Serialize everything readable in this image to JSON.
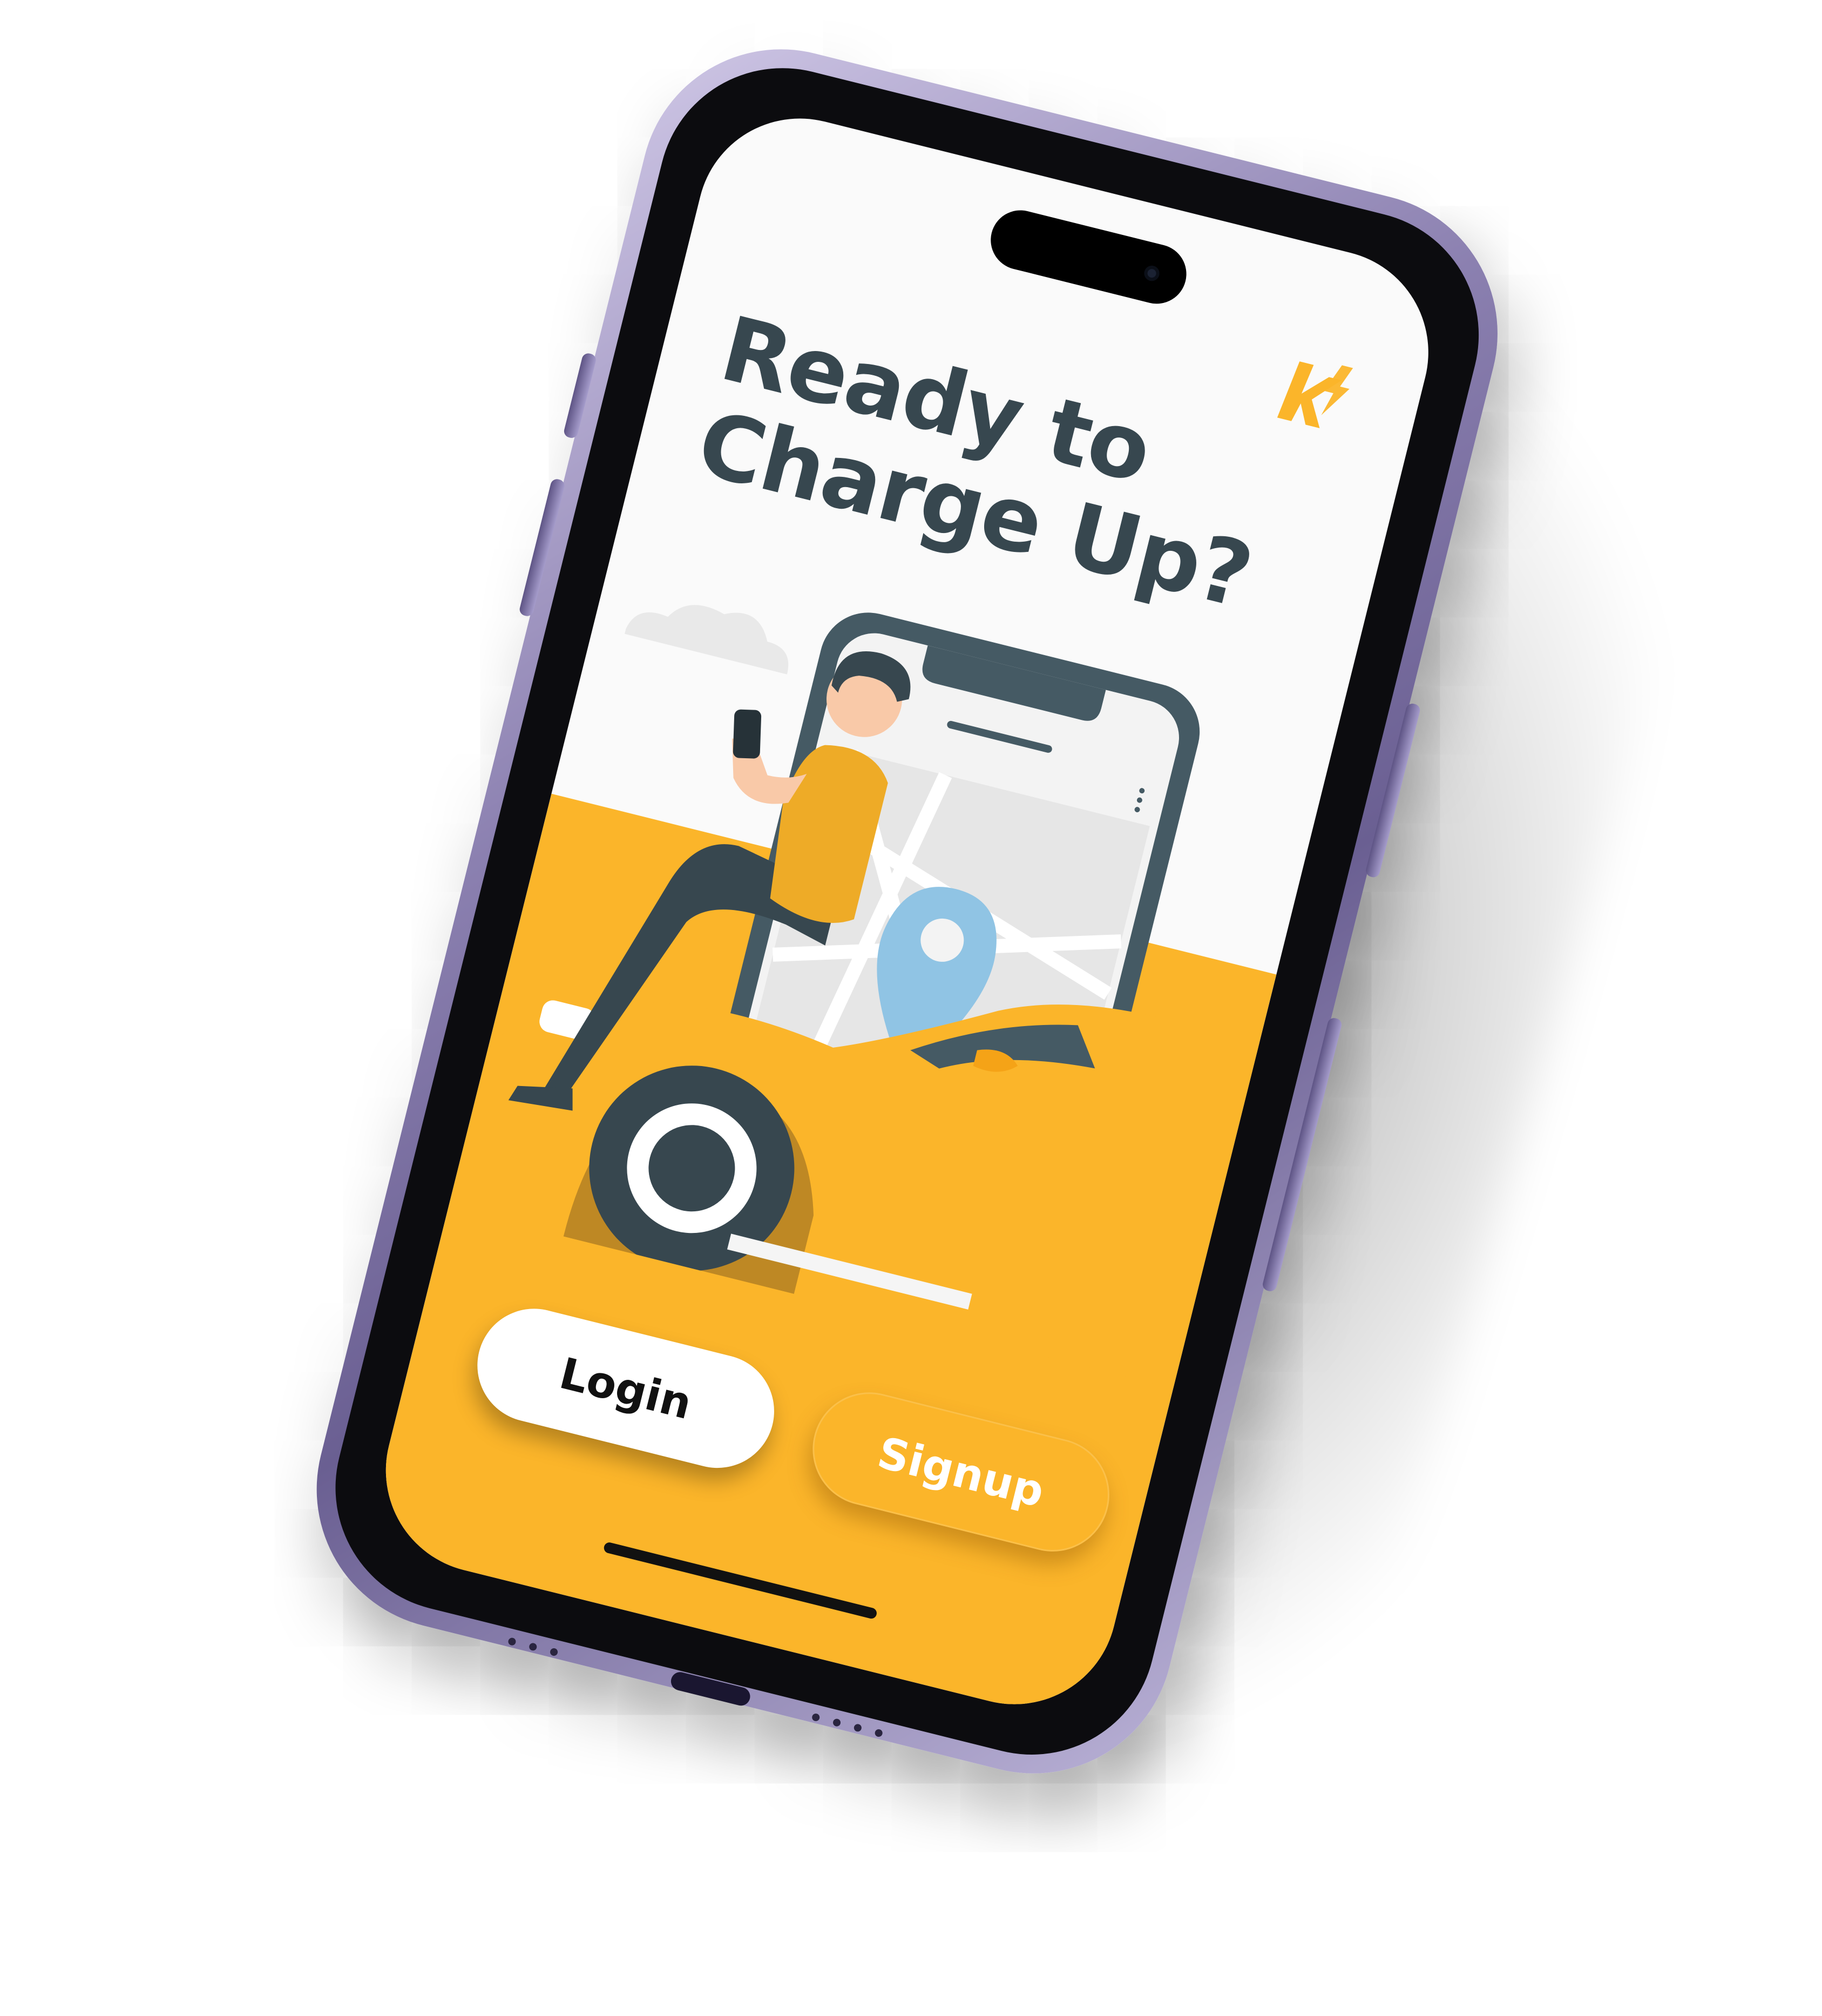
{
  "app": {
    "logo_icon": "bolt-k-logo-icon",
    "headline_line1": "Ready to",
    "headline_line2": "Charge Up?",
    "illustration": "man-sitting-on-car-with-phone-map-illustration",
    "buttons": {
      "login_label": "Login",
      "signup_label": "Signup"
    }
  },
  "colors": {
    "accent": "#fbb52a",
    "headline": "#37474f",
    "pin": "#90c4e4",
    "phone_frame": "#7a6fa3"
  }
}
